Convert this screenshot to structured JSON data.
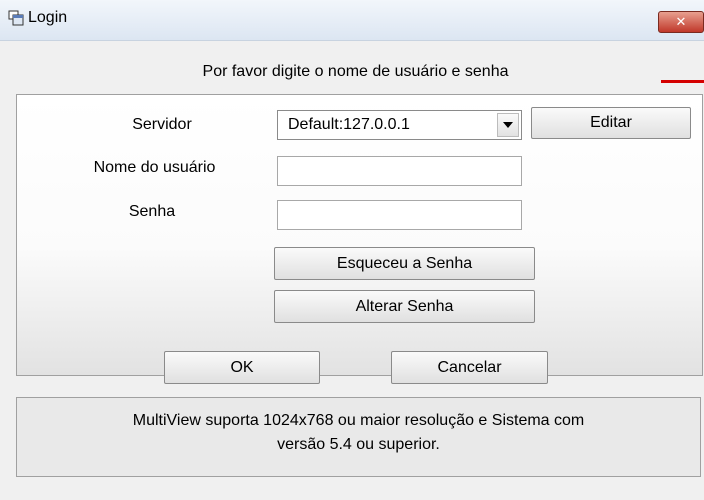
{
  "window": {
    "title": "Login",
    "close_label": "✕"
  },
  "instruction": "Por favor digite o nome de usuário e senha",
  "form": {
    "server_label": "Servidor",
    "server_value": "Default:127.0.0.1",
    "edit_button": "Editar",
    "username_label": "Nome do usuário",
    "username_value": "",
    "password_label": "Senha",
    "password_value": "",
    "forgot_button": "Esqueceu a Senha",
    "change_button": "Alterar Senha"
  },
  "actions": {
    "ok": "OK",
    "cancel": "Cancelar"
  },
  "info": {
    "line1": "MultiView suporta 1024x768 ou maior resolução e Sistema com",
    "line2": "versão 5.4 ou superior."
  },
  "colors": {
    "annotation_line": "#d40000"
  }
}
